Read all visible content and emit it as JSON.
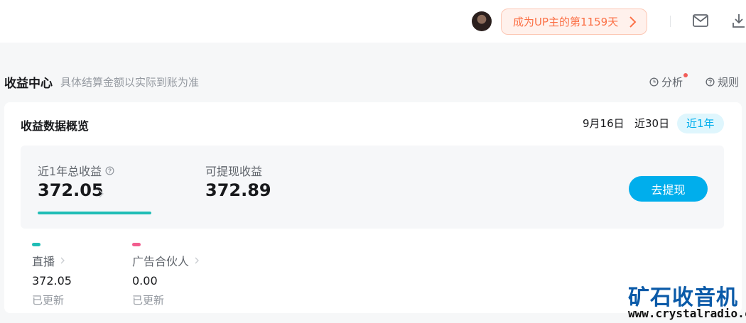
{
  "header": {
    "up_badge": "成为UP主的第1159天"
  },
  "page": {
    "title": "收益中心",
    "subtitle": "具体结算金额以实际到账为准",
    "analysis_label": "分析",
    "rules_label": "规则"
  },
  "overview": {
    "title": "收益数据概览",
    "ranges": [
      "9月16日",
      "近30日",
      "近1年"
    ],
    "selected_range": "近1年",
    "total_label": "近1年总收益",
    "total_value": "372.05",
    "withdrawable_label": "可提现收益",
    "withdrawable_value": "372.89",
    "withdraw_button": "去提现",
    "progress_fraction": 1.0,
    "colors": {
      "accent": "#00aeec",
      "live": "#1fbdb6",
      "ad": "#f25d8e"
    }
  },
  "sources": [
    {
      "name": "直播",
      "value": "372.05",
      "status": "已更新"
    },
    {
      "name": "广告合伙人",
      "value": "0.00",
      "status": "已更新"
    }
  ],
  "watermark": {
    "title": "矿石收音机",
    "url": "www.crystalradio.cn"
  }
}
